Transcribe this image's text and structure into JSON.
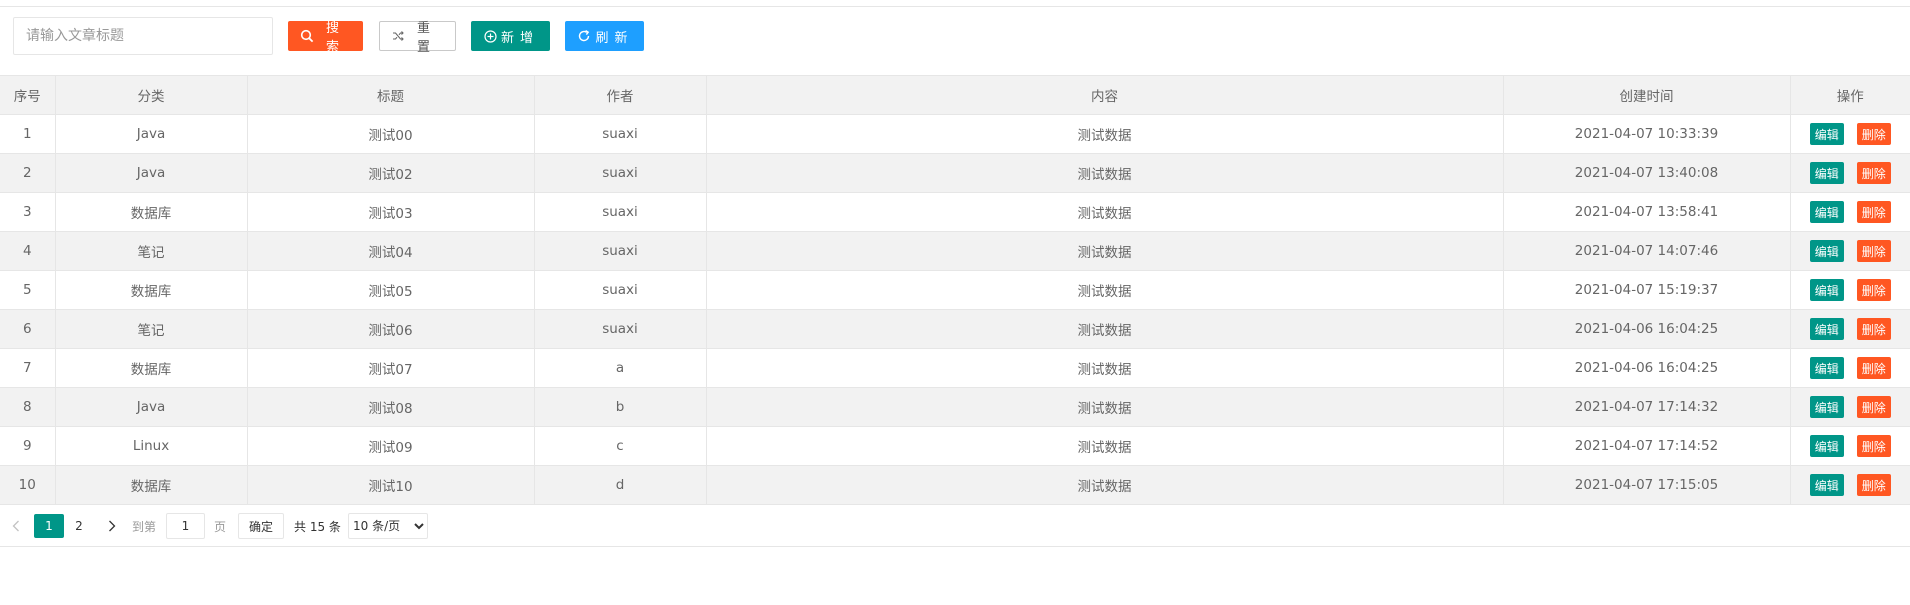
{
  "search": {
    "placeholder": "请输入文章标题",
    "value": ""
  },
  "toolbar": {
    "search_label": "搜索",
    "reset_label": "重置",
    "add_label": "新增",
    "refresh_label": "刷新"
  },
  "colors": {
    "warm": "#ff5722",
    "green": "#009688",
    "blue": "#1e9fff"
  },
  "icons": {
    "search": "search-icon",
    "reset": "shuffle-icon",
    "add": "plus-circle-icon",
    "refresh": "refresh-icon"
  },
  "table": {
    "headers": [
      "序号",
      "分类",
      "标题",
      "作者",
      "内容",
      "创建时间",
      "操作"
    ],
    "rows": [
      {
        "no": "1",
        "category": "Java",
        "title": "测试00",
        "author": "suaxi",
        "content": "测试数据",
        "created": "2021-04-07 10:33:39"
      },
      {
        "no": "2",
        "category": "Java",
        "title": "测试02",
        "author": "suaxi",
        "content": "测试数据",
        "created": "2021-04-07 13:40:08"
      },
      {
        "no": "3",
        "category": "数据库",
        "title": "测试03",
        "author": "suaxi",
        "content": "测试数据",
        "created": "2021-04-07 13:58:41"
      },
      {
        "no": "4",
        "category": "笔记",
        "title": "测试04",
        "author": "suaxi",
        "content": "测试数据",
        "created": "2021-04-07 14:07:46"
      },
      {
        "no": "5",
        "category": "数据库",
        "title": "测试05",
        "author": "suaxi",
        "content": "测试数据",
        "created": "2021-04-07 15:19:37"
      },
      {
        "no": "6",
        "category": "笔记",
        "title": "测试06",
        "author": "suaxi",
        "content": "测试数据",
        "created": "2021-04-06 16:04:25"
      },
      {
        "no": "7",
        "category": "数据库",
        "title": "测试07",
        "author": "a",
        "content": "测试数据",
        "created": "2021-04-06 16:04:25"
      },
      {
        "no": "8",
        "category": "Java",
        "title": "测试08",
        "author": "b",
        "content": "测试数据",
        "created": "2021-04-07 17:14:32"
      },
      {
        "no": "9",
        "category": "Linux",
        "title": "测试09",
        "author": "c",
        "content": "测试数据",
        "created": "2021-04-07 17:14:52"
      },
      {
        "no": "10",
        "category": "数据库",
        "title": "测试10",
        "author": "d",
        "content": "测试数据",
        "created": "2021-04-07 17:15:05"
      }
    ],
    "row_actions": {
      "edit_label": "编辑",
      "delete_label": "删除"
    }
  },
  "pager": {
    "pages": [
      "1",
      "2"
    ],
    "current": "1",
    "goto_label": "到第",
    "goto_value": "1",
    "page_suffix": "页",
    "confirm_label": "确定",
    "total_text": "共 15 条",
    "page_size_selected": "10 条/页"
  }
}
